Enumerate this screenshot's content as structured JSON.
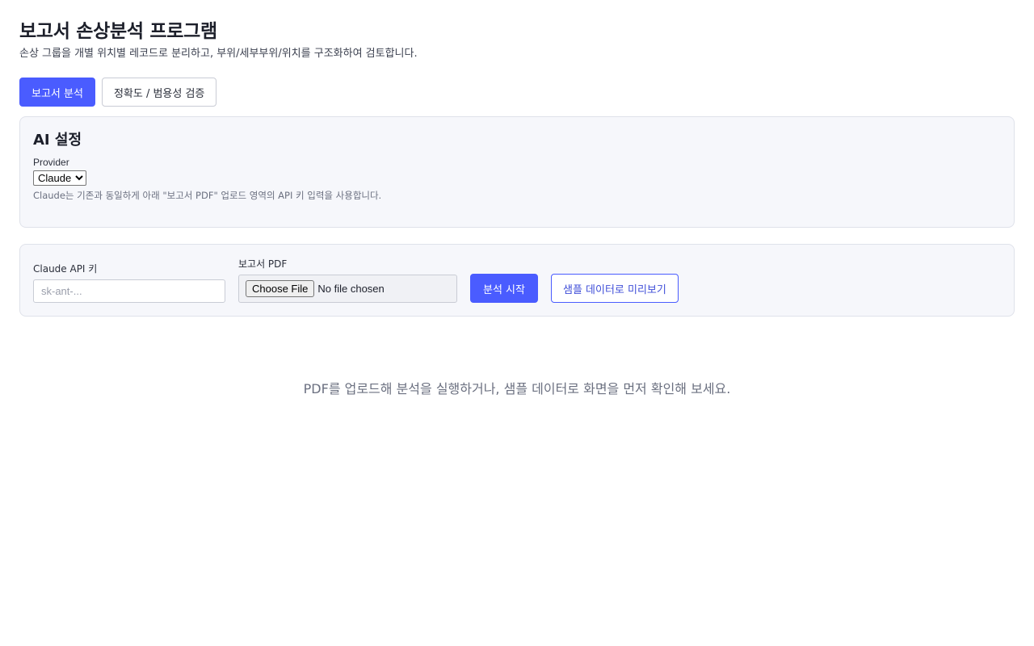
{
  "header": {
    "title": "보고서 손상분석 프로그램",
    "subtitle": "손상 그룹을 개별 위치별 레코드로 분리하고, 부위/세부부위/위치를 구조화하여 검토합니다."
  },
  "tabs": [
    {
      "label": "보고서 분석",
      "active": true
    },
    {
      "label": "정확도 / 범용성 검증",
      "active": false
    }
  ],
  "ai_settings": {
    "title": "AI 설정",
    "provider_label": "Provider",
    "provider_selected": "Claude",
    "help_text": "Claude는 기존과 동일하게 아래 \"보고서 PDF\" 업로드 영역의 API 키 입력을 사용합니다."
  },
  "upload": {
    "api_key_label": "Claude API 키",
    "api_key_placeholder": "sk-ant-...",
    "pdf_label": "보고서 PDF",
    "file_button_label": "Choose File",
    "file_status": "No file chosen",
    "start_button_label": "분석 시작",
    "sample_button_label": "샘플 데이터로 미리보기"
  },
  "empty_state": {
    "message": "PDF를 업로드해 분석을 실행하거나, 샘플 데이터로 화면을 먼저 확인해 보세요."
  },
  "colors": {
    "accent": "#4a5cff",
    "panel_bg": "#f6f7fb",
    "panel_border": "#dfe2ea"
  }
}
